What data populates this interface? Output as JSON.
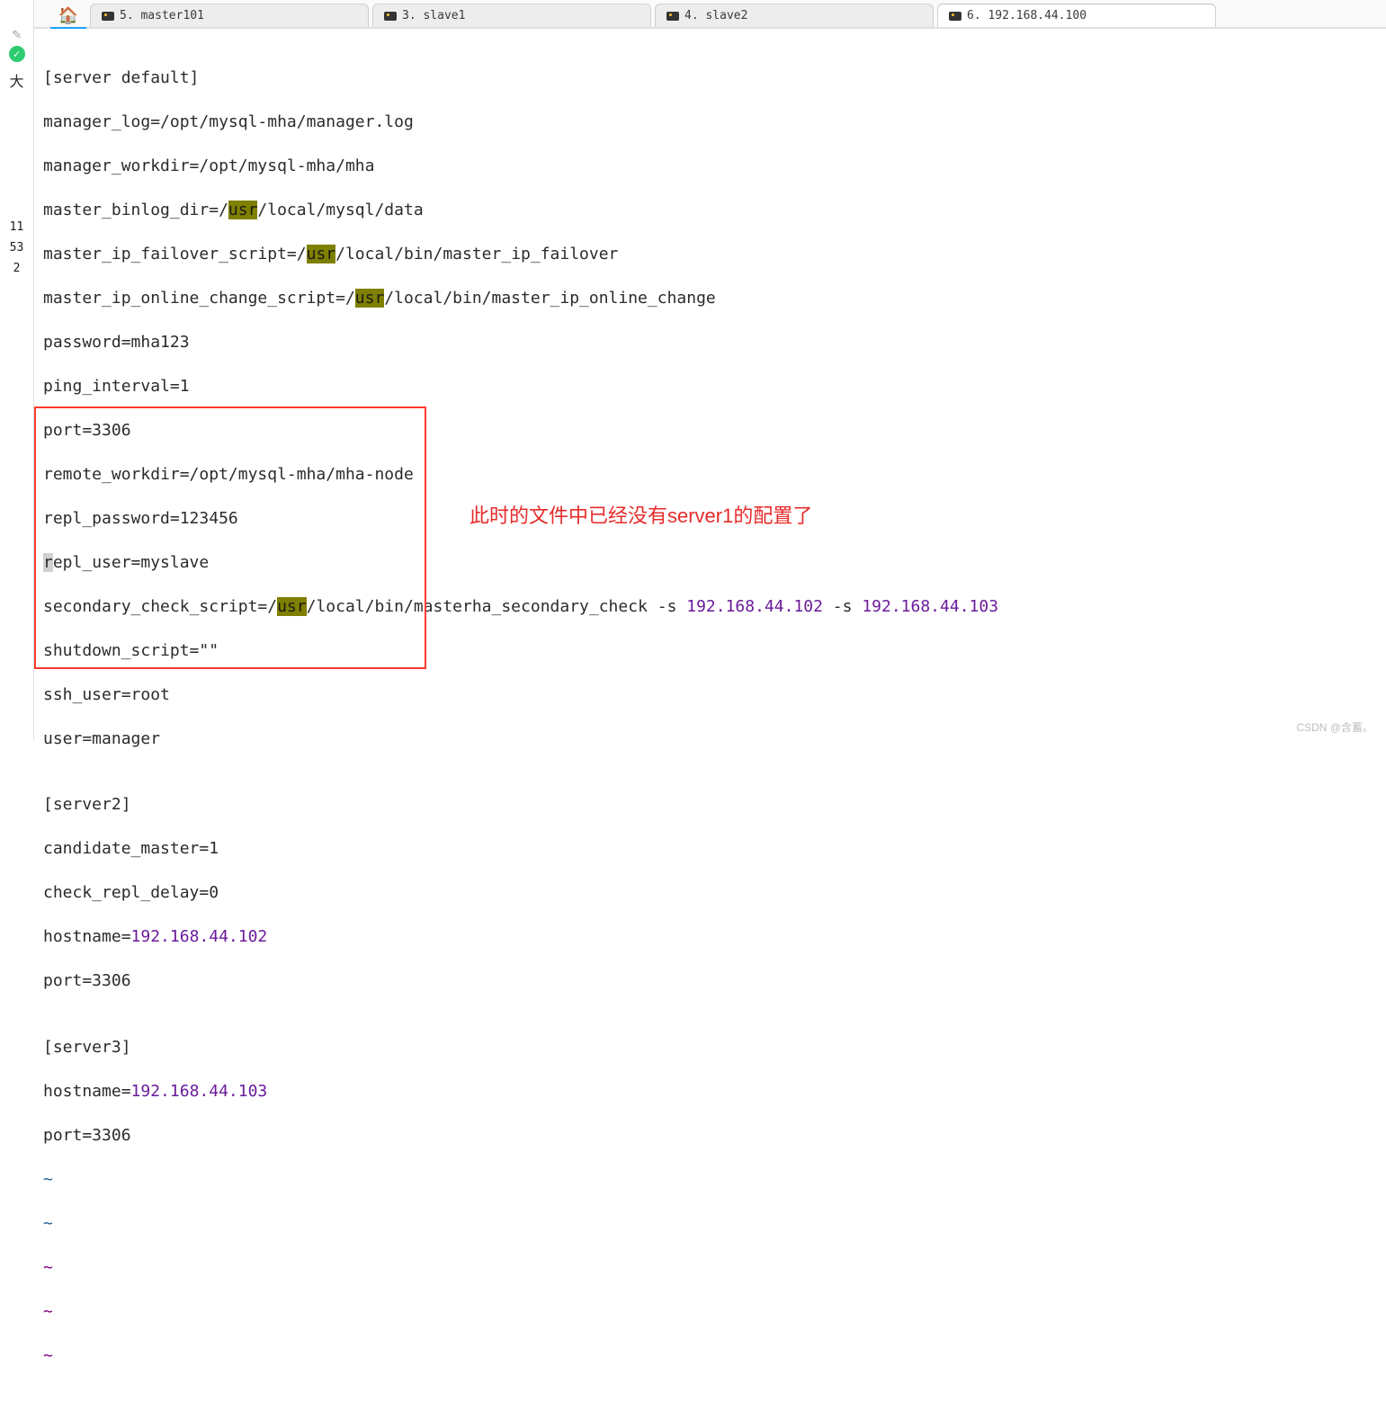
{
  "sidebar": {
    "lang_char": "大",
    "nums": [
      "11",
      "53",
      "2"
    ]
  },
  "tabs": [
    {
      "label": "5. master101",
      "active": false
    },
    {
      "label": "3. slave1",
      "active": false
    },
    {
      "label": "4. slave2",
      "active": false
    },
    {
      "label": "6. 192.168.44.100",
      "active": true
    }
  ],
  "code": {
    "l01": "[server default]",
    "l02": "manager_log=/opt/mysql-mha/manager.log",
    "l03": "manager_workdir=/opt/mysql-mha/mha",
    "l04a": "master_binlog_dir=/",
    "l04u": "usr",
    "l04b": "/local/mysql/data",
    "l05a": "master_ip_failover_script=/",
    "l05u": "usr",
    "l05b": "/local/bin/master_ip_failover",
    "l06a": "master_ip_online_change_script=/",
    "l06u": "usr",
    "l06b": "/local/bin/master_ip_online_change",
    "l07": "password=mha123",
    "l08": "ping_interval=1",
    "l09": "port=3306",
    "l10": "remote_workdir=/opt/mysql-mha/mha-node",
    "l11": "repl_password=123456",
    "l12a": "r",
    "l12b": "epl_user=myslave",
    "l13a": "secondary_check_script=/",
    "l13u": "usr",
    "l13b": "/local/bin/masterha_secondary_check -s ",
    "l13ip1": "192.168.44.102",
    "l13c": " -s ",
    "l13ip2": "192.168.44.103",
    "l14": "shutdown_script=\"\"",
    "l15": "ssh_user=root",
    "l16": "user=manager",
    "l17": "",
    "l18": "[server2]",
    "l19": "candidate_master=1",
    "l20": "check_repl_delay=0",
    "l21a": "hostname=",
    "l21ip": "192.168.44.102",
    "l22": "port=3306",
    "l23": "",
    "l24": "[server3]",
    "l25a": "hostname=",
    "l25ip": "192.168.44.103",
    "l26": "port=3306",
    "tilde": "~"
  },
  "annotation": "此时的文件中已经没有server1的配置了",
  "watermark": "CSDN @含蓄。"
}
